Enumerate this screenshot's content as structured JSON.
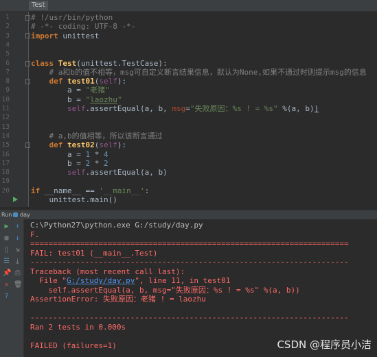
{
  "editor": {
    "tab_label": "Test",
    "line_numbers": [
      "1",
      "2",
      "3",
      "4",
      "5",
      "6",
      "7",
      "8",
      "9",
      "10",
      "11",
      "12",
      "13",
      "14",
      "15",
      "16",
      "17",
      "18",
      "19",
      "20"
    ],
    "lines": {
      "l1": "# !/usr/bin/python",
      "l2": "# -*- coding: UTF-8 -*-",
      "l3_kw": "import",
      "l3_rest": " unittest",
      "l6_kw": "class",
      "l6_name": " Test",
      "l6_rest": "(unittest.TestCase):",
      "l7": "    # a和b的值不相等，msg可自定义断言结果信息，默认为None,如果不通过时则提示msg的信息",
      "l8_kw": "    def",
      "l8_fn": " test01",
      "l8_p1": "(",
      "l8_self": "self",
      "l8_p2": "):",
      "l9_a": "        a = ",
      "l9_s": "\"老猪\"",
      "l10_a": "        b = ",
      "l10_s1": "\"",
      "l10_su": "laozhu",
      "l10_s2": "\"",
      "l11_self": "        self",
      "l11_a": ".assertEqual(a, b, ",
      "l11_msg": "msg",
      "l11_eq": "=",
      "l11_s": "\"失败原因：%s ! = %s\"",
      "l11_rest": " %(a, b)",
      "l11_end": ")",
      "l13": "    # a,b的值相等，所以该断言通过",
      "l14_kw": "    def",
      "l14_fn": " test02",
      "l14_p1": "(",
      "l14_self": "self",
      "l14_p2": "):",
      "l15_a": "        a = ",
      "l15_n1": "1",
      "l15_m": " * ",
      "l15_n2": "4",
      "l16_a": "        b = ",
      "l16_n1": "2",
      "l16_m": " * ",
      "l16_n2": "2",
      "l17_self": "        self",
      "l17_rest": ".assertEqual(a, b)",
      "l19_kw": "if",
      "l19_a": " __name__ == ",
      "l19_s": "'__main__'",
      "l19_c": ":",
      "l20": "    unittest.main()"
    }
  },
  "run_panel": {
    "label": "Run",
    "config_name": "day"
  },
  "console": {
    "cmd": "C:\\Python27\\python.exe G:/study/day.py",
    "result_line": "F.",
    "sep_eq": "======================================================================",
    "fail_line": "FAIL: test01 (__main__.Test)",
    "sep_dash": "----------------------------------------------------------------------",
    "traceback": "Traceback (most recent call last):",
    "file_pre": "  File \"",
    "file_link": "G:/study/day.py",
    "file_post": "\", line 11, in test01",
    "assert_line": "    self.assertEqual(a, b, msg=\"失败原因：%s ! = %s\" %(a, b))",
    "assertion_error": "AssertionError: 失败原因：老猪 ! = laozhu",
    "ran": "Ran 2 tests in 0.000s",
    "failed": "FAILED (failures=1)"
  },
  "watermark": "CSDN @程序员小洁"
}
